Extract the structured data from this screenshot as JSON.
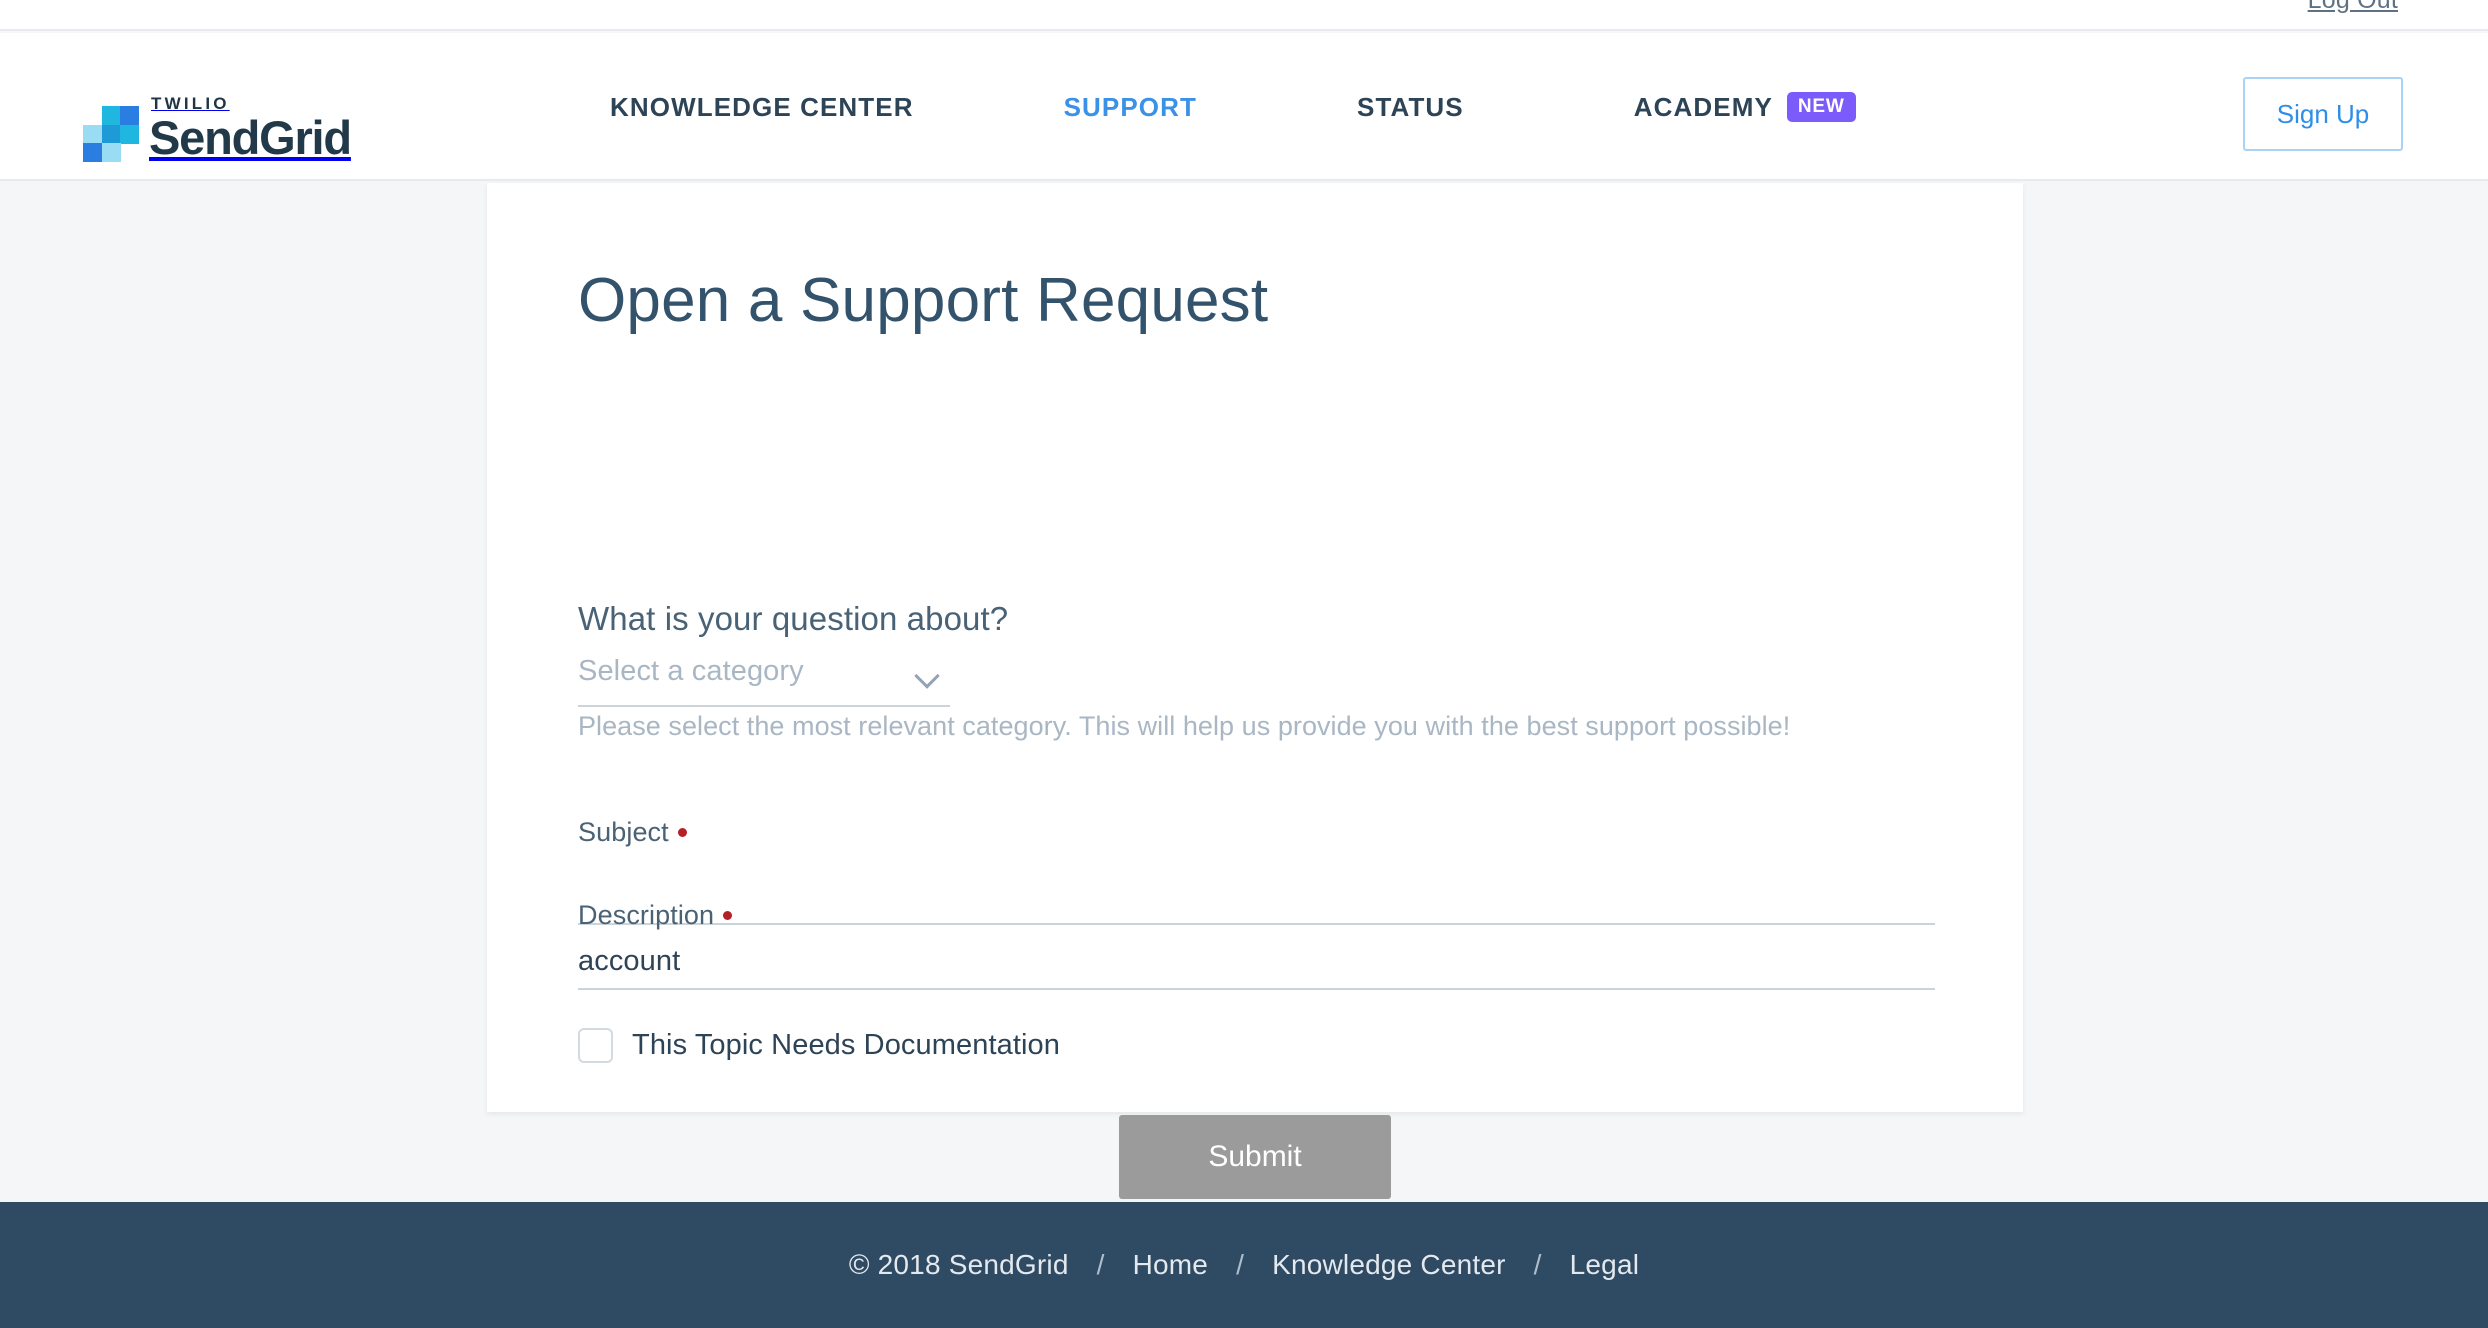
{
  "utility_bar": {
    "logout_label": "Log Out"
  },
  "header": {
    "logo": {
      "twilio_text": "TWILIO",
      "sendgrid_text": "SendGrid",
      "mark_colors": [
        "#1fb6e0",
        "#2a7de1",
        "#9bdcf5",
        "#1e9ad6",
        "#1fb6e0",
        "#2a7de1",
        "#9bdcf5"
      ]
    },
    "nav": [
      {
        "label": "KNOWLEDGE CENTER",
        "active": false
      },
      {
        "label": "SUPPORT",
        "active": true
      },
      {
        "label": "STATUS",
        "active": false
      },
      {
        "label": "ACADEMY",
        "active": false,
        "badge": "NEW"
      }
    ],
    "signup_label": "Sign Up",
    "active_color": "#3b91e8",
    "badge_color": "#7b5cfa"
  },
  "main": {
    "title": "Open a Support Request",
    "category": {
      "label": "What is your question about?",
      "selected": "Select a category",
      "helper": "Please select the most relevant category. This will help us provide you with the best support possible!"
    },
    "subject": {
      "label": "Subject",
      "value": "",
      "placeholder": "",
      "required": true
    },
    "description": {
      "label": "Description",
      "value": "account",
      "placeholder": "",
      "required": true
    },
    "documentation_checkbox": {
      "label": "This Topic Needs Documentation",
      "checked": false
    },
    "submit_label": "Submit",
    "submit_color": "#9b9b9b"
  },
  "footer": {
    "copyright": "© 2018 SendGrid",
    "separator": "/",
    "links": [
      {
        "label": "Home"
      },
      {
        "label": "Knowledge Center"
      },
      {
        "label": "Legal"
      }
    ],
    "background": "#2f4a63"
  }
}
